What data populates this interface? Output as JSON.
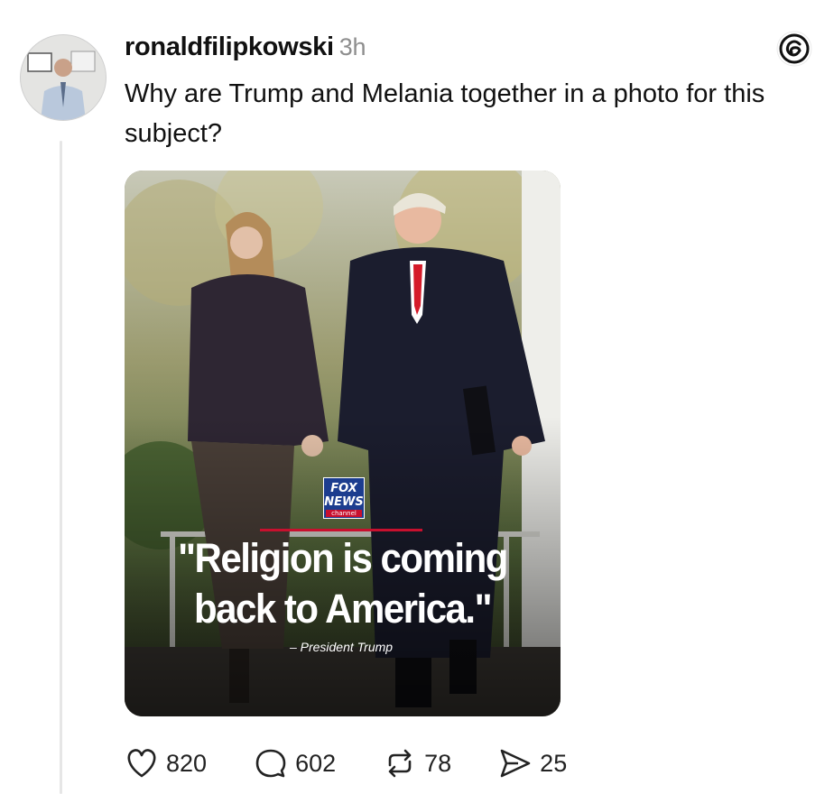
{
  "post": {
    "username": "ronaldfilipkowski",
    "time": "3h",
    "text": "Why are Trump and Melania together in a photo for this subject?",
    "avatar_icon": "avatar"
  },
  "image": {
    "logo": {
      "line1": "FOX",
      "line2": "NEWS",
      "line3": "channel"
    },
    "quote": "\"Religion is coming back to America.\"",
    "attribution": "– President Trump"
  },
  "actions": {
    "likes": "820",
    "replies": "602",
    "reposts": "78",
    "shares": "25"
  },
  "icons": [
    "heart-icon",
    "comment-icon",
    "repost-icon",
    "share-icon",
    "threads-logo-icon"
  ],
  "colors": {
    "accent": "#c8102e",
    "text": "#111111",
    "muted": "#8e8e8e"
  }
}
